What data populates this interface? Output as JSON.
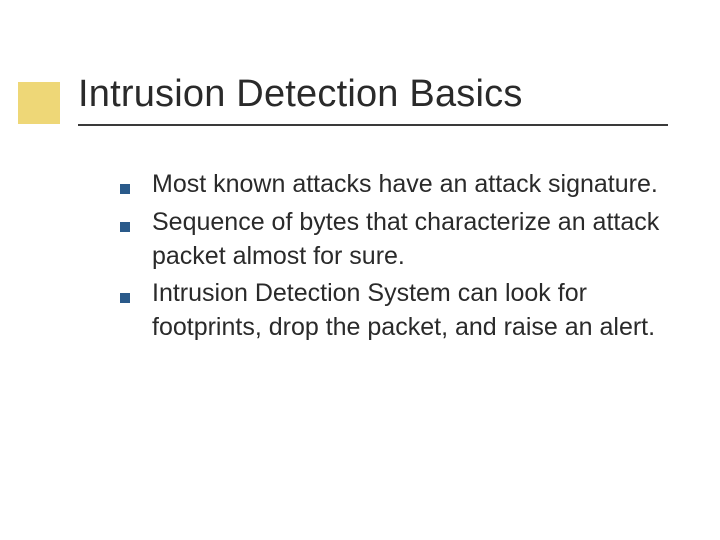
{
  "slide": {
    "title": "Intrusion Detection Basics",
    "bullets": [
      "Most known attacks have an attack signature.",
      "Sequence of bytes that characterize an attack packet almost for sure.",
      "Intrusion Detection System can look for footprints, drop the packet, and raise an alert."
    ]
  }
}
